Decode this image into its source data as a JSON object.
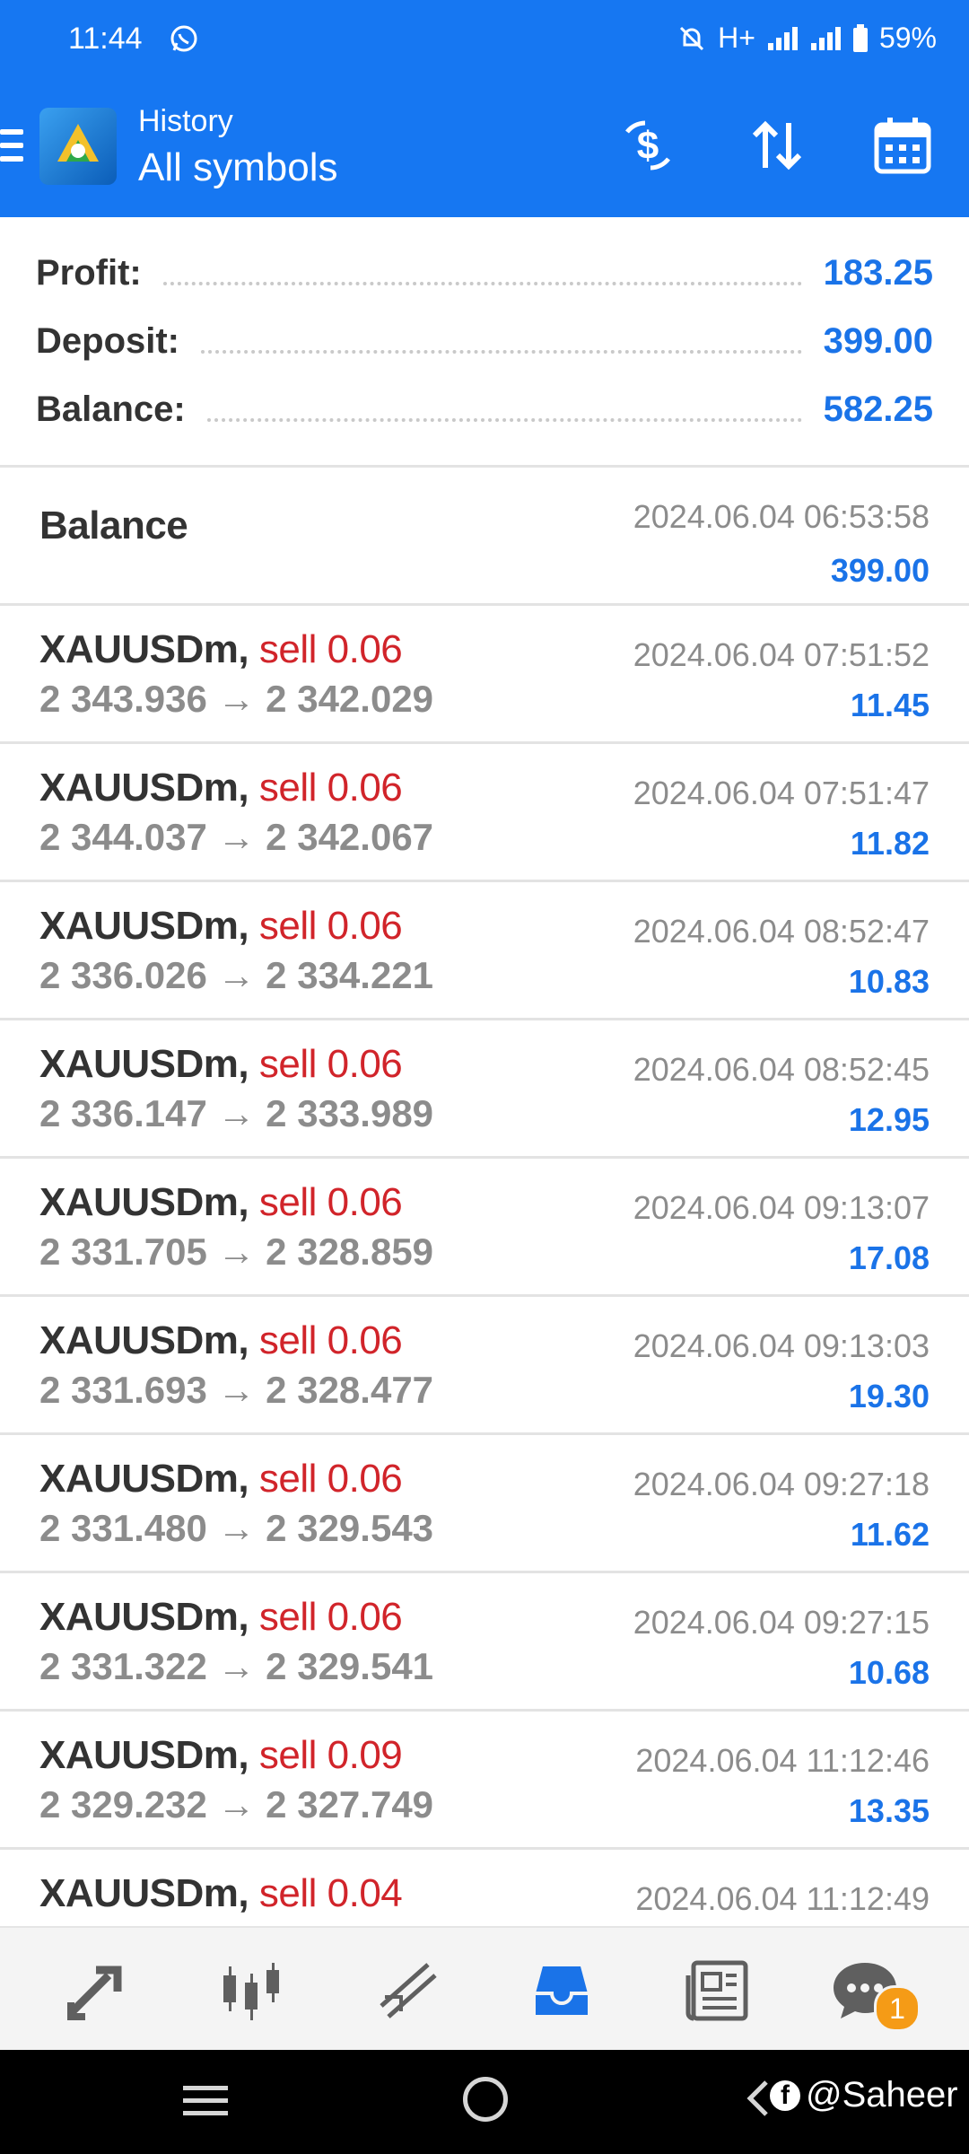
{
  "status_bar": {
    "time": "11:44",
    "network": "H+",
    "battery": "59%"
  },
  "app_bar": {
    "title": "History",
    "subtitle": "All symbols",
    "accent_color": "#1677f2",
    "icons": [
      "menu-icon",
      "app-logo-icon",
      "currency-exchange-icon",
      "sort-icon",
      "calendar-icon"
    ]
  },
  "summary": {
    "profit_label": "Profit:",
    "profit_value": "183.25",
    "deposit_label": "Deposit:",
    "deposit_value": "399.00",
    "balance_label": "Balance:",
    "balance_value": "582.25"
  },
  "balance_entry": {
    "label": "Balance",
    "time": "2024.06.04 06:53:58",
    "amount": "399.00"
  },
  "deals": [
    {
      "symbol": "XAUUSDm,",
      "action": "sell 0.06",
      "prices": "2 343.936 → 2 342.029",
      "time": "2024.06.04 07:51:52",
      "profit": "11.45"
    },
    {
      "symbol": "XAUUSDm,",
      "action": "sell 0.06",
      "prices": "2 344.037 → 2 342.067",
      "time": "2024.06.04 07:51:47",
      "profit": "11.82"
    },
    {
      "symbol": "XAUUSDm,",
      "action": "sell 0.06",
      "prices": "2 336.026 → 2 334.221",
      "time": "2024.06.04 08:52:47",
      "profit": "10.83"
    },
    {
      "symbol": "XAUUSDm,",
      "action": "sell 0.06",
      "prices": "2 336.147 → 2 333.989",
      "time": "2024.06.04 08:52:45",
      "profit": "12.95"
    },
    {
      "symbol": "XAUUSDm,",
      "action": "sell 0.06",
      "prices": "2 331.705 → 2 328.859",
      "time": "2024.06.04 09:13:07",
      "profit": "17.08"
    },
    {
      "symbol": "XAUUSDm,",
      "action": "sell 0.06",
      "prices": "2 331.693 → 2 328.477",
      "time": "2024.06.04 09:13:03",
      "profit": "19.30"
    },
    {
      "symbol": "XAUUSDm,",
      "action": "sell 0.06",
      "prices": "2 331.480 → 2 329.543",
      "time": "2024.06.04 09:27:18",
      "profit": "11.62"
    },
    {
      "symbol": "XAUUSDm,",
      "action": "sell 0.06",
      "prices": "2 331.322 → 2 329.541",
      "time": "2024.06.04 09:27:15",
      "profit": "10.68"
    },
    {
      "symbol": "XAUUSDm,",
      "action": "sell 0.09",
      "prices": "2 329.232 → 2 327.749",
      "time": "2024.06.04 11:12:46",
      "profit": "13.35"
    },
    {
      "symbol": "XAUUSDm,",
      "action": "sell 0.04",
      "prices": "",
      "time": "2024.06.04 11:12:49",
      "profit": ""
    }
  ],
  "bottom_nav": {
    "items": [
      "quotes-icon",
      "chart-icon",
      "trade-icon",
      "history-icon",
      "news-icon",
      "chat-icon"
    ],
    "active": "history-icon",
    "chat_badge": "1"
  },
  "watermark": {
    "text": "@Saheer"
  },
  "colors": {
    "sell": "#d1242a",
    "value": "#1a73e8",
    "muted": "#8c8c8c"
  }
}
